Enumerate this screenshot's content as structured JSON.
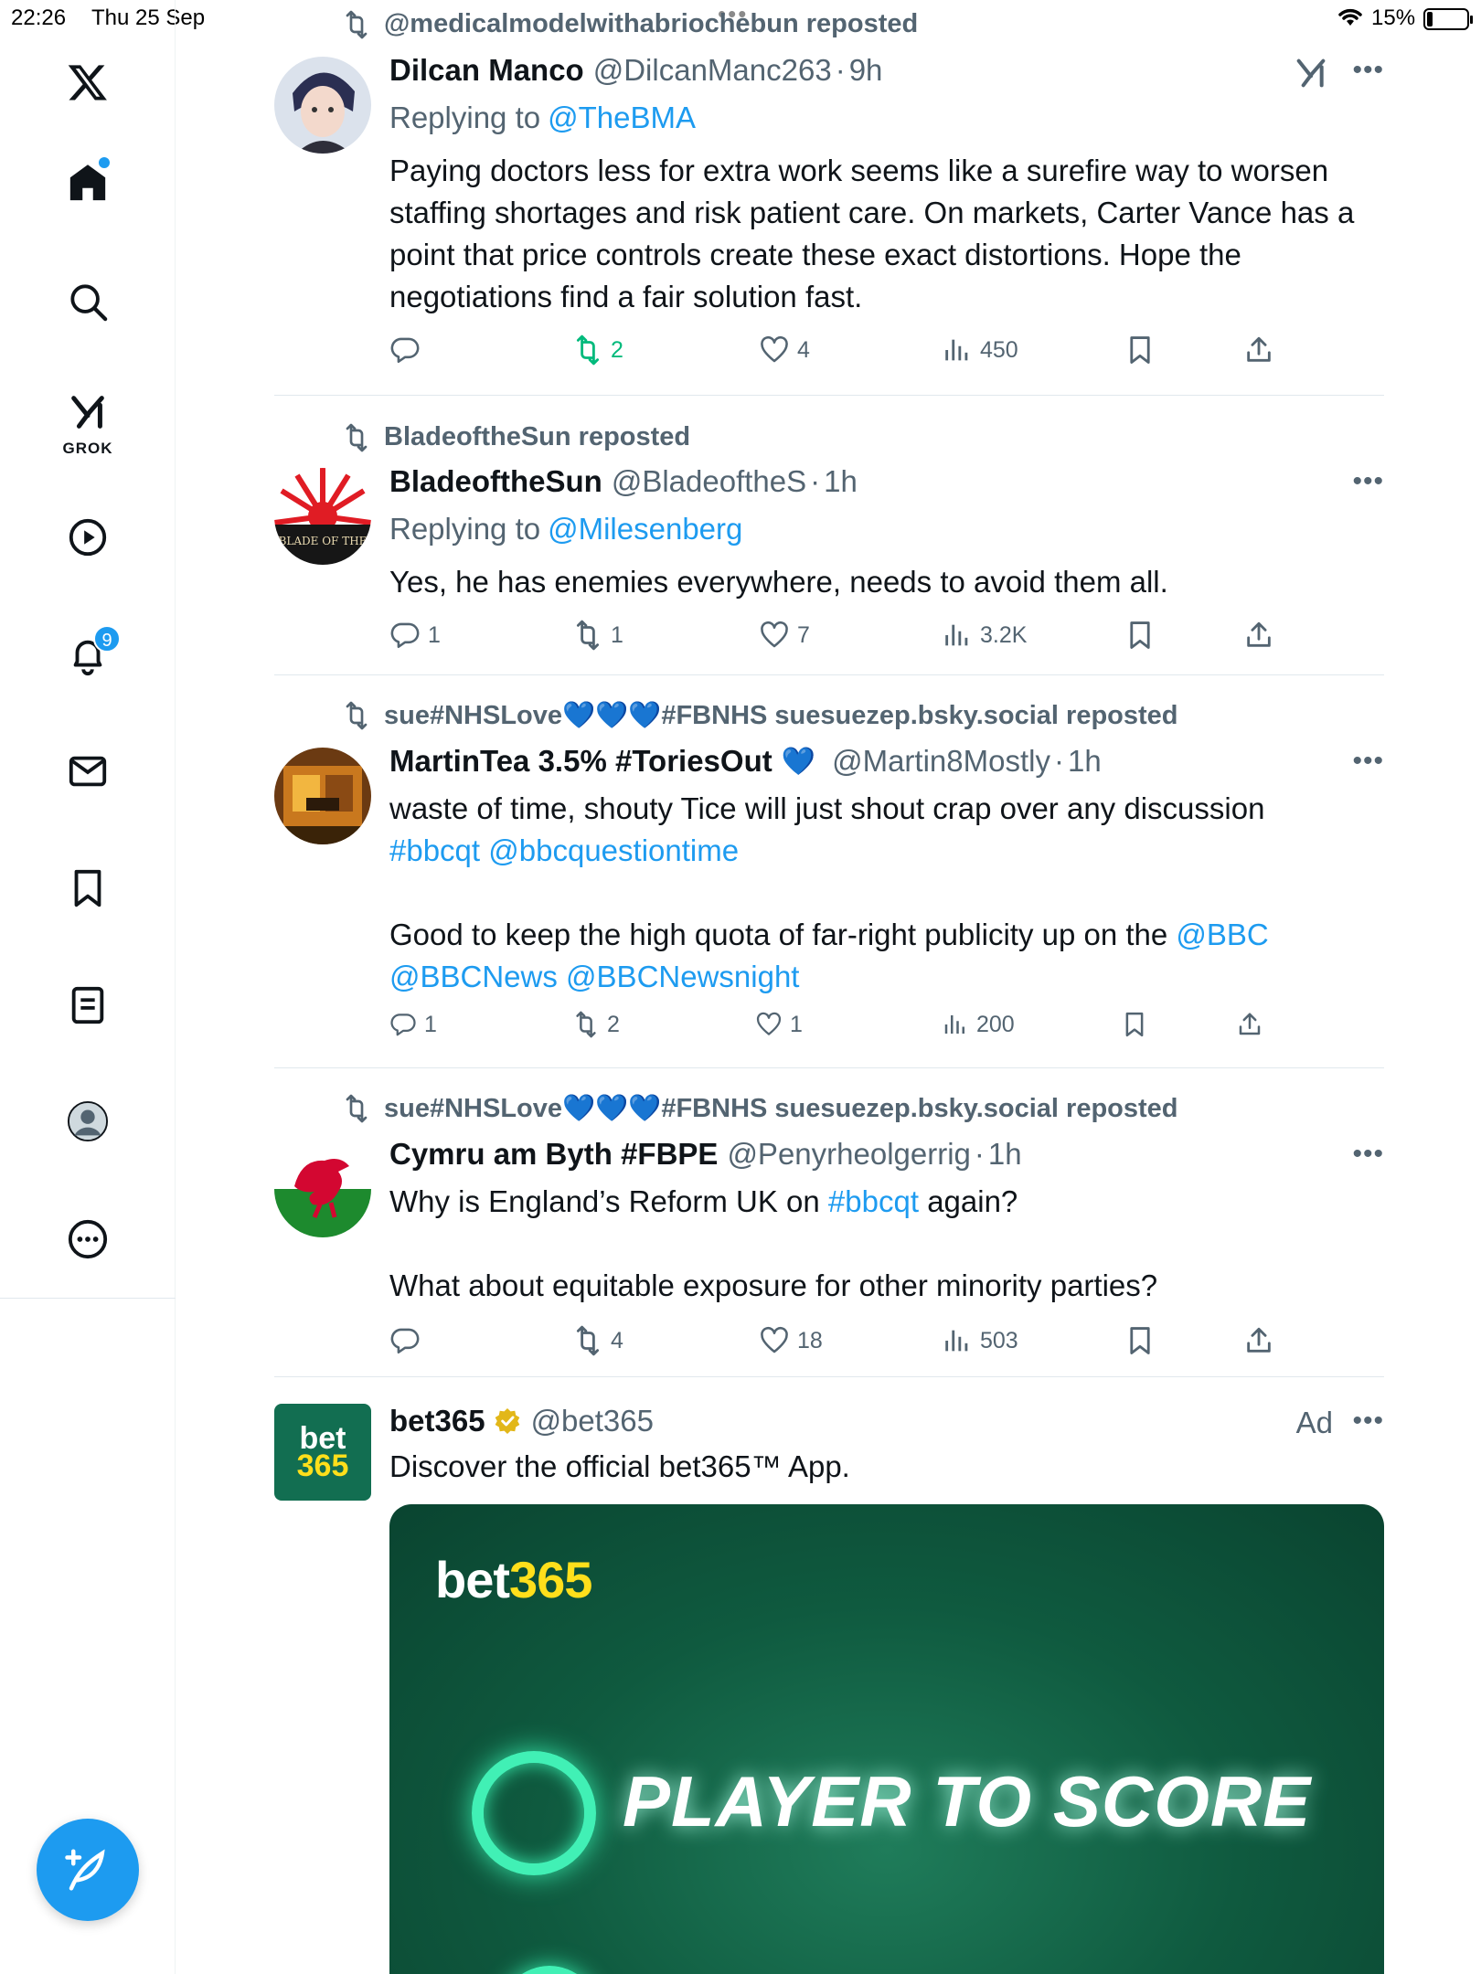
{
  "status_bar": {
    "time": "22:26",
    "date": "Thu 25 Sep",
    "battery_pct": "15%",
    "battery_level": 0.15
  },
  "sidebar": {
    "items": [
      {
        "name": "x-logo"
      },
      {
        "name": "home",
        "has_dot": true
      },
      {
        "name": "search"
      },
      {
        "name": "grok",
        "label": "GROK"
      },
      {
        "name": "video"
      },
      {
        "name": "notifications",
        "badge": "9"
      },
      {
        "name": "messages"
      },
      {
        "name": "bookmarks"
      },
      {
        "name": "lists"
      },
      {
        "name": "profile"
      },
      {
        "name": "more"
      }
    ],
    "compose": "compose-icon"
  },
  "colors": {
    "accent": "#1d9bf0",
    "muted": "#536471",
    "repost_green": "#00ba7c",
    "ad_green": "#126e51",
    "ad_yellow": "#ffdf1b"
  },
  "posts": [
    {
      "repost_by": "@medicalmodelwithabriochebun reposted",
      "name": "Dilcan Manco",
      "handle": "@DilcanManc263",
      "time": "9h",
      "replying_label": "Replying to",
      "replying_to": "@TheBMA",
      "text": "Paying doctors less for extra work seems like a surefire way to worsen staffing shortages and risk patient care. On markets, Carter Vance has a point that price controls create these exact distortions. Hope the negotiations find a fair solution fast.",
      "replies": "",
      "reposts": "2",
      "likes": "4",
      "views": "450"
    },
    {
      "repost_by": "BladeoftheSun reposted",
      "name": "BladeoftheSun",
      "handle": "@BladeoftheS",
      "time": "1h",
      "replying_label": "Replying to",
      "replying_to": "@Milesenberg",
      "text": "Yes, he has enemies everywhere, needs to avoid them all.",
      "replies": "1",
      "reposts": "1",
      "likes": "7",
      "views": "3.2K",
      "avatar_text": "BLADE OF THE"
    },
    {
      "repost_by": "sue#NHSLove💙💙💙#FBNHS suesuezep.bsky.social reposted",
      "name": "MartinTea 3.5% #ToriesOut",
      "name_emoji": "💙",
      "handle": "@Martin8Mostly",
      "time": "1h",
      "text_parts": {
        "line1": "waste of time, shouty Tice will just shout crap over any discussion",
        "tag1": "#bbcqt",
        "mention1": "@bbcquestiontime",
        "line3": "Good to keep the high quota of far-right publicity up on the",
        "mention2": "@BBC",
        "mention3": "@BBCNews",
        "mention4": "@BBCNewsnight"
      },
      "replies": "1",
      "reposts": "2",
      "likes": "1",
      "views": "200"
    },
    {
      "repost_by": "sue#NHSLove💙💙💙#FBNHS suesuezep.bsky.social reposted",
      "name": "Cymru am Byth #FBPE",
      "handle": "@Penyrheolgerrig",
      "time": "1h",
      "text_parts": {
        "pre": "Why is England’s Reform UK on",
        "tag": "#bbcqt",
        "post": "again?",
        "line2": "What about equitable exposure for other minority parties?"
      },
      "replies": "",
      "reposts": "4",
      "likes": "18",
      "views": "503"
    }
  ],
  "ad": {
    "name": "bet365",
    "handle": "@bet365",
    "ad_label": "Ad",
    "text": "Discover the official bet365™ App.",
    "avatar_line1": "bet",
    "avatar_line2": "365",
    "media_brand_white": "bet",
    "media_brand_yellow": "365",
    "media_headline": "PLAYER TO SCORE"
  }
}
